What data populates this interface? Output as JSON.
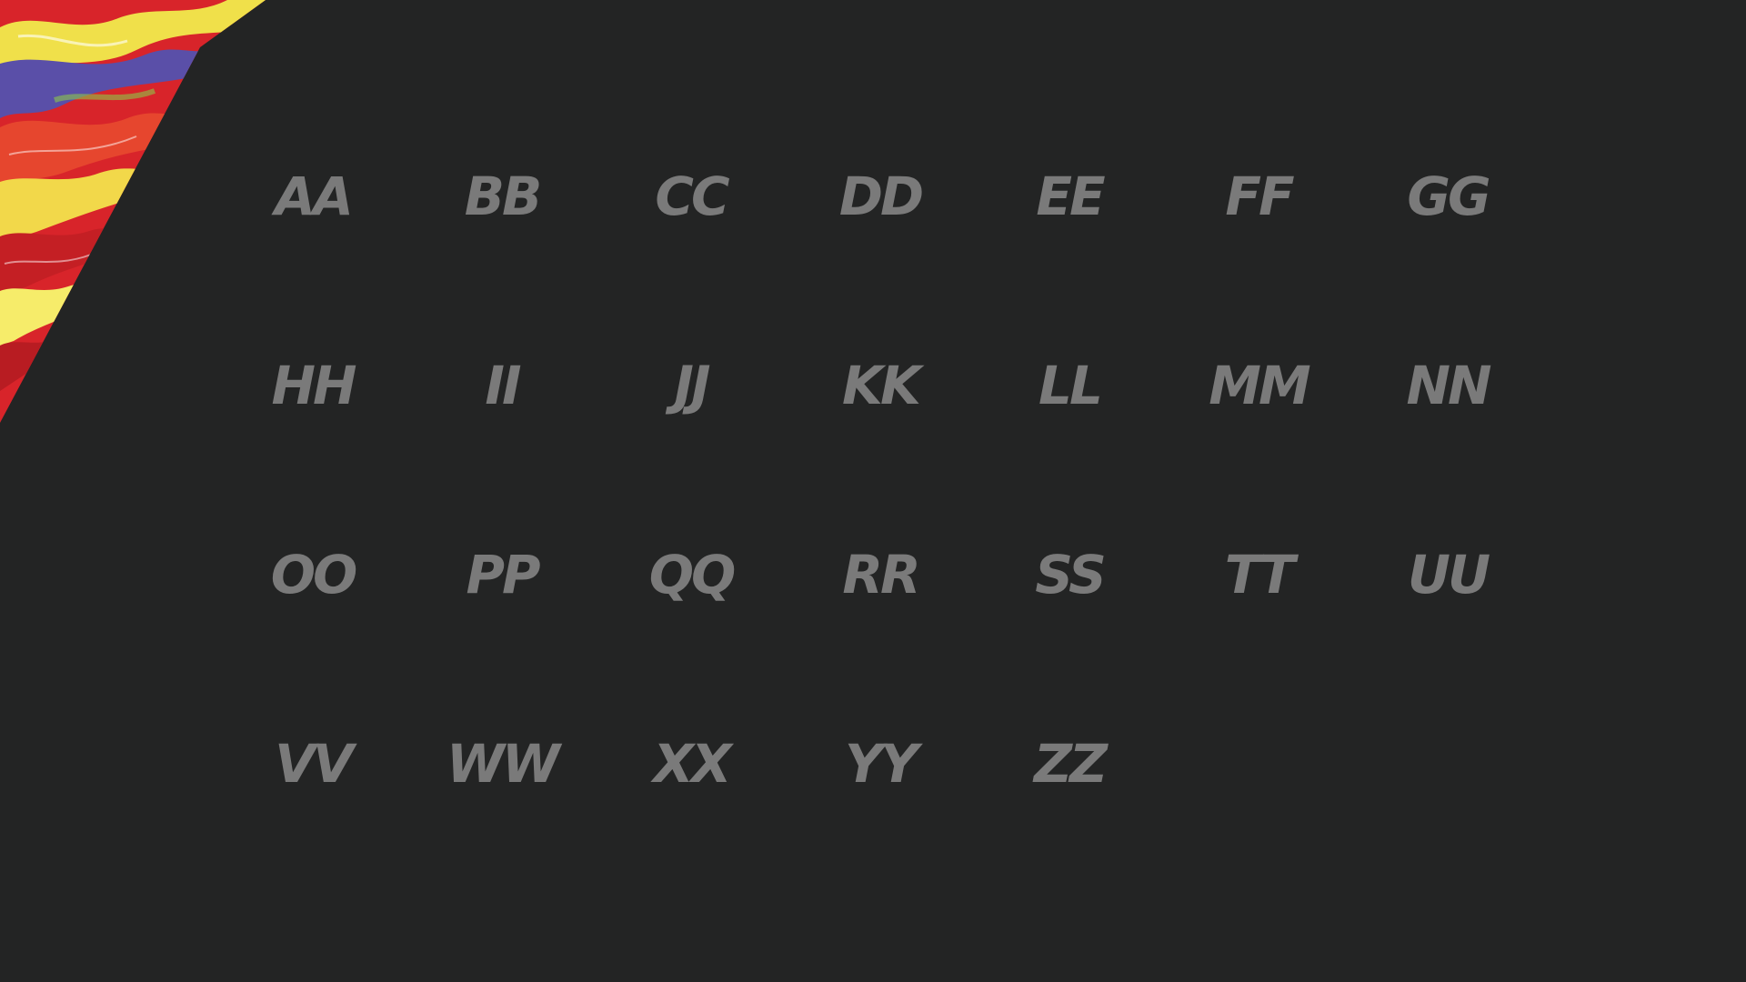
{
  "colors": {
    "background": "#232424",
    "glyph": "#7a7a7a"
  },
  "glyphs": [
    "AA",
    "BB",
    "CC",
    "DD",
    "EE",
    "FF",
    "GG",
    "HH",
    "II",
    "JJ",
    "KK",
    "LL",
    "MM",
    "NN",
    "OO",
    "PP",
    "QQ",
    "RR",
    "SS",
    "TT",
    "UU",
    "VV",
    "WW",
    "XX",
    "YY",
    "ZZ"
  ]
}
